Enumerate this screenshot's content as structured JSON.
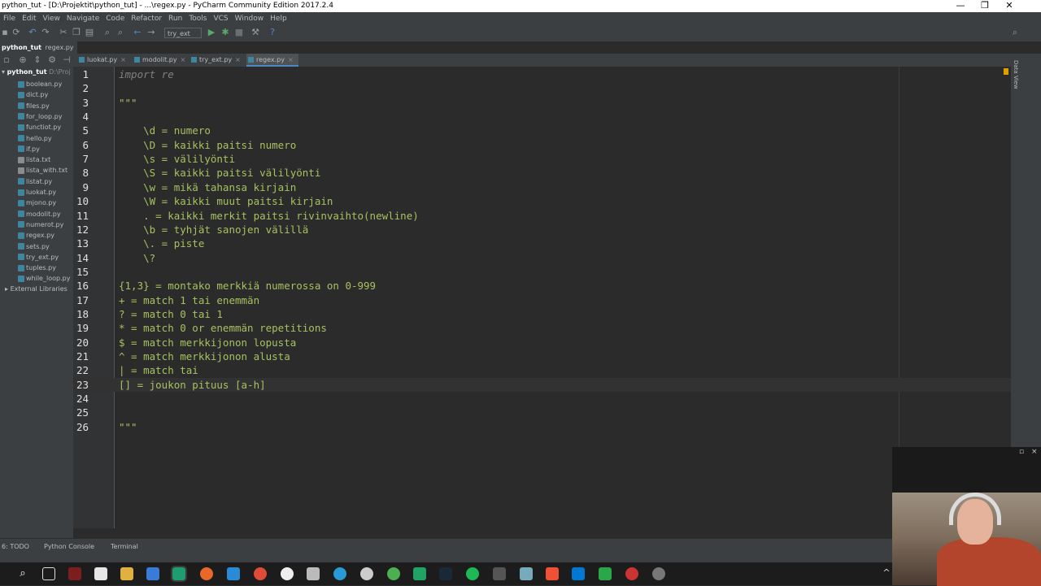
{
  "window": {
    "title": "python_tut - [D:\\Projektit\\python_tut] - ...\\regex.py - PyCharm Community Edition 2017.2.4",
    "minimize": "—",
    "maximize": "❐",
    "close": "✕"
  },
  "menu": [
    "File",
    "Edit",
    "View",
    "Navigate",
    "Code",
    "Refactor",
    "Run",
    "Tools",
    "VCS",
    "Window",
    "Help"
  ],
  "toolbar": {
    "run_config": "try_ext"
  },
  "navbar": {
    "project": "python_tut",
    "file": "regex.py"
  },
  "project_tree": {
    "root_name": "python_tut",
    "root_path": "D:\\Proj",
    "files": [
      "boolean.py",
      "dict.py",
      "files.py",
      "for_loop.py",
      "functiot.py",
      "hello.py",
      "if.py",
      "lista.txt",
      "lista_with.txt",
      "listat.py",
      "luokat.py",
      "mjono.py",
      "modolit.py",
      "numerot.py",
      "regex.py",
      "sets.py",
      "try_ext.py",
      "tuples.py",
      "while_loop.py"
    ],
    "external": "External Libraries"
  },
  "tabs": [
    {
      "label": "luokat.py"
    },
    {
      "label": "modolit.py"
    },
    {
      "label": "try_ext.py"
    },
    {
      "label": "regex.py"
    }
  ],
  "editor": {
    "current_line": 23,
    "lines": [
      {
        "n": "1",
        "text": "import re"
      },
      {
        "n": "2",
        "text": ""
      },
      {
        "n": "3",
        "text": "\"\"\""
      },
      {
        "n": "4",
        "text": ""
      },
      {
        "n": "5",
        "text": "    \\d = numero"
      },
      {
        "n": "6",
        "text": "    \\D = kaikki paitsi numero"
      },
      {
        "n": "7",
        "text": "    \\s = välilyönti"
      },
      {
        "n": "8",
        "text": "    \\S = kaikki paitsi välilyönti"
      },
      {
        "n": "9",
        "text": "    \\w = mikä tahansa kirjain"
      },
      {
        "n": "10",
        "text": "    \\W = kaikki muut paitsi kirjain"
      },
      {
        "n": "11",
        "text": "    . = kaikki merkit paitsi rivinvaihto(newline)"
      },
      {
        "n": "12",
        "text": "    \\b = tyhjät sanojen välillä"
      },
      {
        "n": "13",
        "text": "    \\. = piste"
      },
      {
        "n": "14",
        "text": "    \\?"
      },
      {
        "n": "15",
        "text": ""
      },
      {
        "n": "16",
        "text": "{1,3} = montako merkkiä numerossa on 0-999"
      },
      {
        "n": "17",
        "text": "+ = match 1 tai enemmän"
      },
      {
        "n": "18",
        "text": "? = match 0 tai 1"
      },
      {
        "n": "19",
        "text": "* = match 0 or enemmän repetitions"
      },
      {
        "n": "20",
        "text": "$ = match merkkijonon lopusta"
      },
      {
        "n": "21",
        "text": "^ = match merkkijonon alusta"
      },
      {
        "n": "22",
        "text": "| = match tai"
      },
      {
        "n": "23",
        "text": "[] = joukon pituus [a-h]"
      },
      {
        "n": "24",
        "text": ""
      },
      {
        "n": "25",
        "text": ""
      },
      {
        "n": "26",
        "text": "\"\"\""
      }
    ]
  },
  "right_panel": {
    "data_view": "Data View"
  },
  "bottom_tools": [
    "6: TODO",
    "Python Console",
    "Terminal"
  ]
}
